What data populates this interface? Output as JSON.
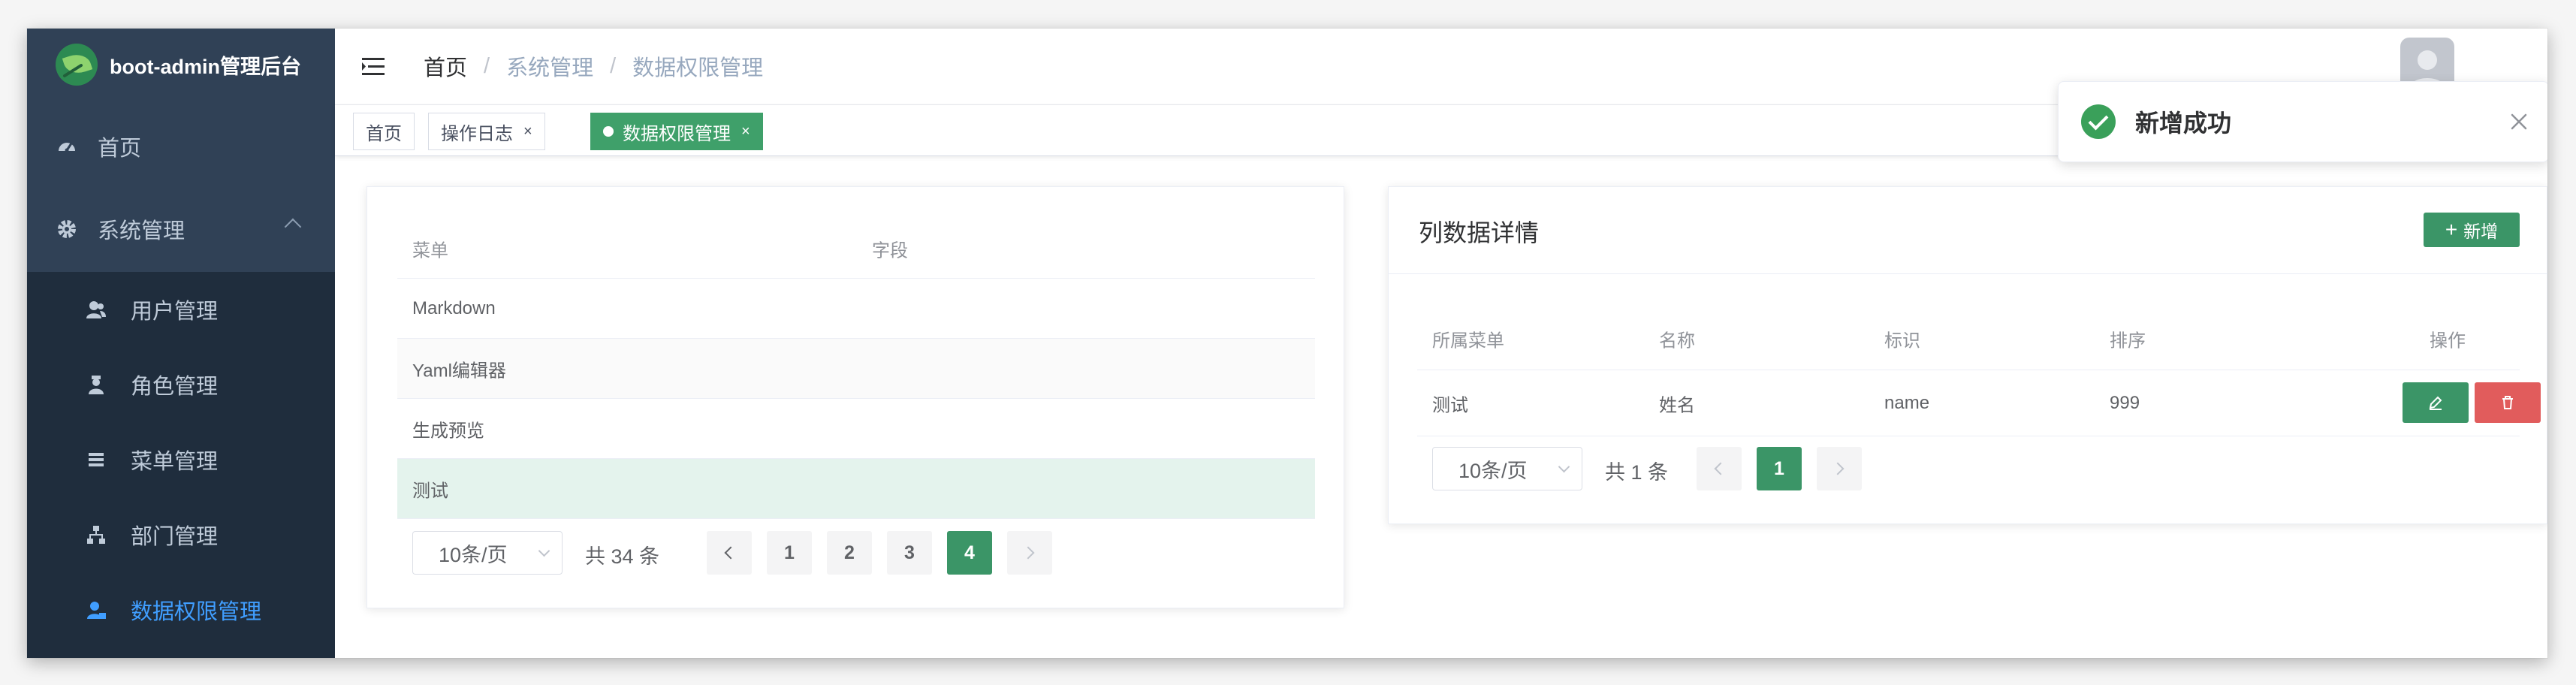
{
  "app": {
    "title": "boot-admin管理后台"
  },
  "sidebar": {
    "items": [
      {
        "label": "首页",
        "icon": "dashboard-icon"
      },
      {
        "label": "系统管理",
        "icon": "gear-icon",
        "expanded": true
      }
    ],
    "sub_items": [
      {
        "label": "用户管理",
        "icon": "user-icon"
      },
      {
        "label": "角色管理",
        "icon": "role-icon"
      },
      {
        "label": "菜单管理",
        "icon": "list-icon"
      },
      {
        "label": "部门管理",
        "icon": "tree-icon"
      },
      {
        "label": "数据权限管理",
        "icon": "user-lock-icon",
        "active": true
      }
    ],
    "colors": {
      "background": "#304156",
      "submenu_background": "#1f2d3d",
      "text": "#bfcbd9",
      "active": "#409eff"
    }
  },
  "header": {
    "breadcrumb": [
      "首页",
      "系统管理",
      "数据权限管理"
    ]
  },
  "tags": [
    {
      "label": "首页"
    },
    {
      "label": "操作日志",
      "close": "×"
    },
    {
      "label": "数据权限管理",
      "close": "×",
      "active": true
    }
  ],
  "left_table": {
    "columns": [
      "菜单",
      "字段"
    ],
    "rows": [
      {
        "menu": "Markdown",
        "field": ""
      },
      {
        "menu": "Yaml编辑器",
        "field": ""
      },
      {
        "menu": "生成预览",
        "field": ""
      },
      {
        "menu": "测试",
        "field": "",
        "selected": true
      }
    ],
    "pagination": {
      "page_size": "10条/页",
      "total": "共 34 条",
      "pages": [
        "1",
        "2",
        "3",
        "4"
      ],
      "current": "4"
    }
  },
  "right_panel": {
    "title": "列数据详情",
    "add_button": "新增",
    "columns": [
      "所属菜单",
      "名称",
      "标识",
      "排序",
      "操作"
    ],
    "rows": [
      {
        "menu": "测试",
        "name": "姓名",
        "key": "name",
        "sort": "999"
      }
    ],
    "pagination": {
      "page_size": "10条/页",
      "total": "共 1 条",
      "pages": [
        "1"
      ],
      "current": "1"
    }
  },
  "toast": {
    "message": "新增成功",
    "type": "success"
  },
  "colors": {
    "primary": "#3b9567",
    "danger": "#e15c5c",
    "success": "#3aa05a"
  }
}
